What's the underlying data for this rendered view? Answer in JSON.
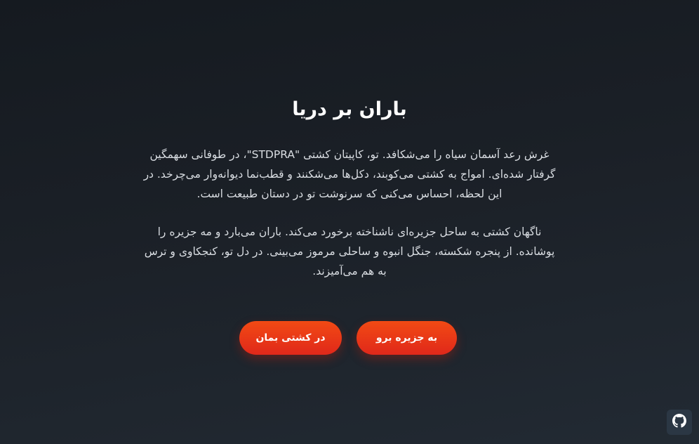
{
  "title": "باران بر دریا",
  "paragraphs": [
    "غرش رعد آسمان سیاه را می‌شکافد. تو، کاپیتان کشتی \"STDPRA\"، در طوفانی سهمگین گرفتار شده‌ای. امواج به کشتی می‌کوبند، دکل‌ها می‌شکنند و قطب‌نما دیوانه‌وار می‌چرخد. در این لحظه، احساس می‌کنی که سرنوشت تو در دستان طبیعت است.",
    "ناگهان کشتی به ساحل جزیره‌ای ناشناخته برخورد می‌کند. باران می‌بارد و مه جزیره را پوشانده. از پنجره شکسته، جنگل انبوه و ساحلی مرموز می‌بینی. در دل تو، کنجکاوی و ترس به هم می‌آمیزند."
  ],
  "buttons": {
    "go_to_island": "به جزیره برو",
    "stay_in_ship": "در کشتی بمان"
  },
  "corner_icon": "github-icon",
  "colors": {
    "accent": "#e8361a",
    "background": "#1b2027",
    "text": "#d9dde2"
  }
}
